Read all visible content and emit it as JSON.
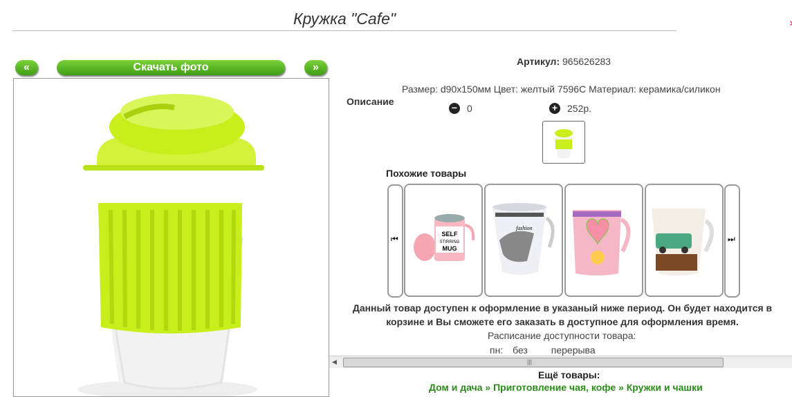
{
  "product": {
    "title": "Кружка \"Cafe\"",
    "article_label": "Артикул:",
    "article_value": "965626283",
    "spec": "Размер: d90x150мм Цвет: желтый 7596С Материал: керамика/силикон",
    "description_label": "Описание",
    "qty_value": "0",
    "price": "252р."
  },
  "gallery": {
    "prev_label": "«",
    "next_label": "»",
    "download_label": "Скачать фото"
  },
  "similar": {
    "title": "Похожие товары",
    "items": [
      {
        "name": "self-stirring-mug",
        "text": "SELF STIRRING MUG"
      },
      {
        "name": "fashion-mug",
        "text": "fashion"
      },
      {
        "name": "pink-heart-mug",
        "text": ""
      },
      {
        "name": "cafe-car-mug",
        "text": ""
      }
    ]
  },
  "availability": {
    "notice": "Данный товар доступен к оформление в указаный ниже период. Он будет находится в корзине и Вы сможете его заказать в доступное для оформления время.",
    "schedule_title": "Расписание доступности товара:",
    "day": "пн:",
    "from": "без",
    "to": "перерыва"
  },
  "more": {
    "title": "Ещё товары:",
    "crumbs": [
      "Дом и дача",
      "Приготовление чая, кофе",
      "Кружки и чашки"
    ],
    "separator": "»"
  },
  "colors": {
    "accent_green": "#4caf1a",
    "lid_yellow": "#c8ef1c",
    "link_green": "#2a8a1a"
  }
}
